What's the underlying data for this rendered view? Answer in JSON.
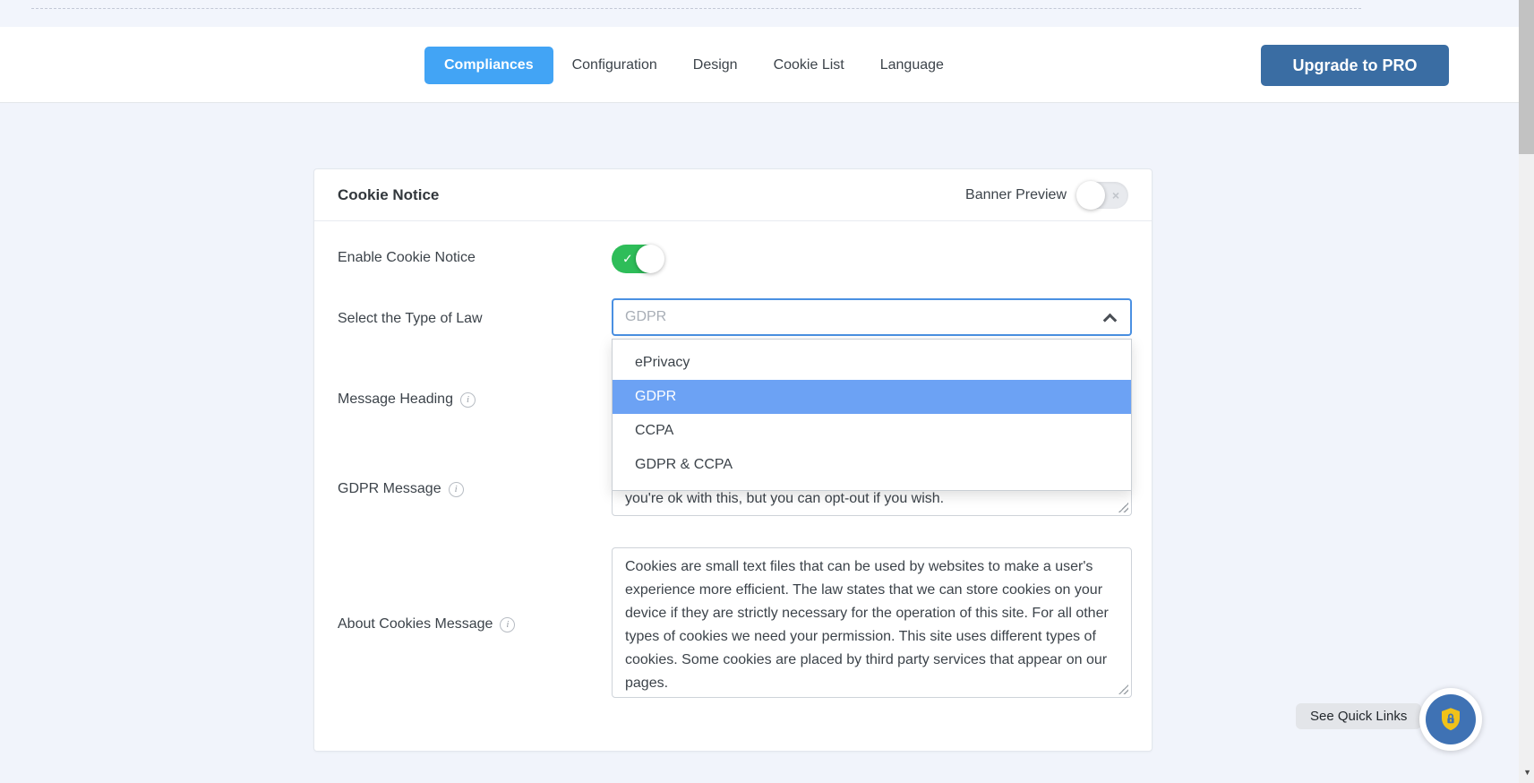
{
  "nav": {
    "tabs": [
      "Compliances",
      "Configuration",
      "Design",
      "Cookie List",
      "Language"
    ],
    "active_tab": "Compliances",
    "upgrade_label": "Upgrade to PRO"
  },
  "card": {
    "title": "Cookie Notice",
    "banner_preview": {
      "label": "Banner Preview",
      "state": "off"
    },
    "enable": {
      "label": "Enable Cookie Notice",
      "state": "on"
    },
    "law": {
      "label": "Select the Type of Law",
      "value": "GDPR",
      "options": [
        "ePrivacy",
        "GDPR",
        "CCPA",
        "GDPR & CCPA"
      ],
      "selected_option": "GDPR"
    },
    "message_heading": {
      "label": "Message Heading"
    },
    "gdpr_message": {
      "label": "GDPR Message",
      "visible_text": "you're ok with this, but you can opt-out if you wish."
    },
    "about_cookies": {
      "label": "About Cookies Message",
      "value": "Cookies are small text files that can be used by websites to make a user's experience more efficient. The law states that we can store cookies on your device if they are strictly necessary for the operation of this site. For all other types of cookies we need your permission. This site uses different types of cookies. Some cookies are placed by third party services that appear on our pages."
    }
  },
  "floating": {
    "quick_links_label": "See Quick Links",
    "fab_icon": "shield-lock-icon"
  },
  "icons": {
    "toggle_on_check": "✓",
    "toggle_off_x": "×",
    "info": "i",
    "scroll_down_arrow": "▼"
  },
  "colors": {
    "page_background": "#f1f4fb",
    "active_tab_blue": "#42a4f5",
    "upgrade_pro_blue": "#3a6da3",
    "toggle_green": "#2ebd59",
    "dropdown_highlight_blue": "#6ca2f4",
    "focused_border_blue": "#4a90e2",
    "fab_circle_blue": "#3f72b4",
    "fab_shield_yellow": "#f0c219"
  }
}
